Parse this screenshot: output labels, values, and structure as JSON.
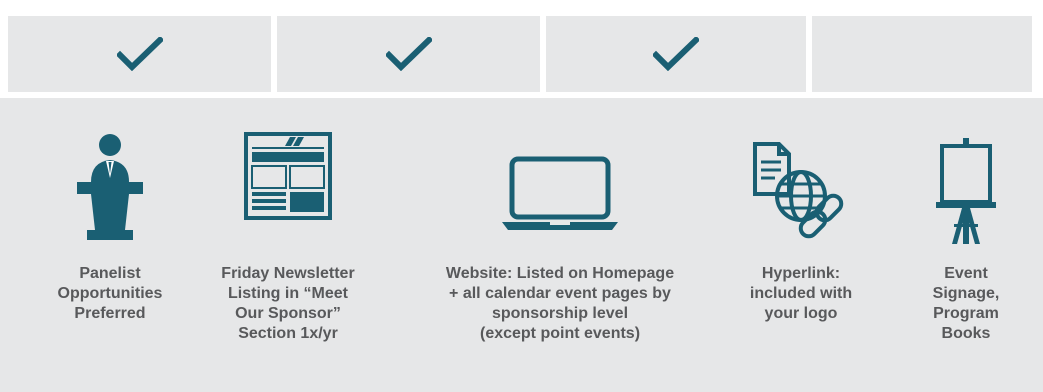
{
  "check_row": {
    "cells": [
      {
        "checked": true,
        "icon": "checkmark-icon"
      },
      {
        "checked": true,
        "icon": "checkmark-icon"
      },
      {
        "checked": true,
        "icon": "checkmark-icon"
      },
      {
        "checked": false,
        "icon": ""
      }
    ]
  },
  "benefits": [
    {
      "icon": "podium-speaker-icon",
      "label": "Panelist\nOpportunities\nPreferred"
    },
    {
      "icon": "newspaper-icon",
      "label": "Friday Newsletter\nListing in “Meet\nOur Sponsor”\nSection 1x/yr"
    },
    {
      "icon": "laptop-icon",
      "label": "Website: Listed on Homepage\n+ all calendar event pages by\nsponsorship level\n(except point events)"
    },
    {
      "icon": "hyperlink-globe-icon",
      "label": "Hyperlink:\nincluded with\nyour logo"
    },
    {
      "icon": "easel-sign-icon",
      "label": "Event\nSignage,\nProgram\nBooks"
    }
  ],
  "colors": {
    "accent": "#1a5f73",
    "panel": "#e6e7e8",
    "text": "#58595b"
  }
}
